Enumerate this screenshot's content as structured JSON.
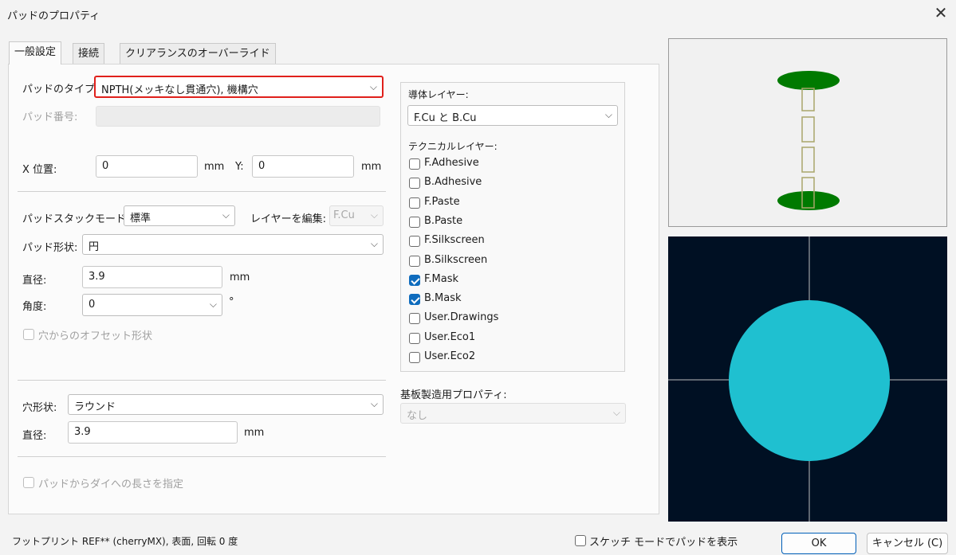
{
  "window": {
    "title": "パッドのプロパティ",
    "close_glyph": "✕"
  },
  "tabs": [
    {
      "label": "一般設定",
      "active": true
    },
    {
      "label": "接続",
      "active": false
    },
    {
      "label": "クリアランスのオーバーライド",
      "active": false
    }
  ],
  "pad": {
    "type_label": "パッドのタイプ:",
    "type_value": "NPTH(メッキなし貫通穴), 機構穴",
    "number_label": "パッド番号:",
    "number_value": "",
    "x_label": "X 位置:",
    "x_value": "0",
    "x_unit": "mm",
    "y_label": "Y:",
    "y_value": "0",
    "y_unit": "mm"
  },
  "padstack": {
    "mode_label": "パッドスタックモード:",
    "mode_value": "標準",
    "edit_layer_label": "レイヤーを編集:",
    "edit_layer_value": "F.Cu",
    "shape_label": "パッド形状:",
    "shape_value": "円",
    "diameter_label": "直径:",
    "diameter_value": "3.9",
    "diameter_unit": "mm",
    "angle_label": "角度:",
    "angle_value": "0",
    "angle_unit": "°",
    "offset_shape_label": "穴からのオフセット形状"
  },
  "hole": {
    "shape_label": "穴形状:",
    "shape_value": "ラウンド",
    "diameter_label": "直径:",
    "diameter_value": "3.9",
    "diameter_unit": "mm"
  },
  "die_length_label": "パッドからダイへの長さを指定",
  "layers": {
    "copper_label": "導体レイヤー:",
    "copper_value": "F.Cu と B.Cu",
    "technical_label": "テクニカルレイヤー:",
    "items": [
      {
        "label": "F.Adhesive",
        "checked": false
      },
      {
        "label": "B.Adhesive",
        "checked": false
      },
      {
        "label": "F.Paste",
        "checked": false
      },
      {
        "label": "B.Paste",
        "checked": false
      },
      {
        "label": "F.Silkscreen",
        "checked": false
      },
      {
        "label": "B.Silkscreen",
        "checked": false
      },
      {
        "label": "F.Mask",
        "checked": true
      },
      {
        "label": "B.Mask",
        "checked": true
      },
      {
        "label": "User.Drawings",
        "checked": false
      },
      {
        "label": "User.Eco1",
        "checked": false
      },
      {
        "label": "User.Eco2",
        "checked": false
      }
    ]
  },
  "fab": {
    "label": "基板製造用プロパティ:",
    "value": "なし"
  },
  "footer": {
    "status": "フットプリント REF** (cherryMX), 表面, 回転 0 度",
    "sketch_label": "スケッチ モードでパッドを表示",
    "ok_label": "OK",
    "cancel_label": "キャンセル (C)"
  },
  "colors": {
    "accent": "#0f6cbd",
    "highlight": "#e0201b",
    "pad_green": "#007a00",
    "pad_cyan": "#1fc0d0",
    "preview_bg": "#001023"
  }
}
